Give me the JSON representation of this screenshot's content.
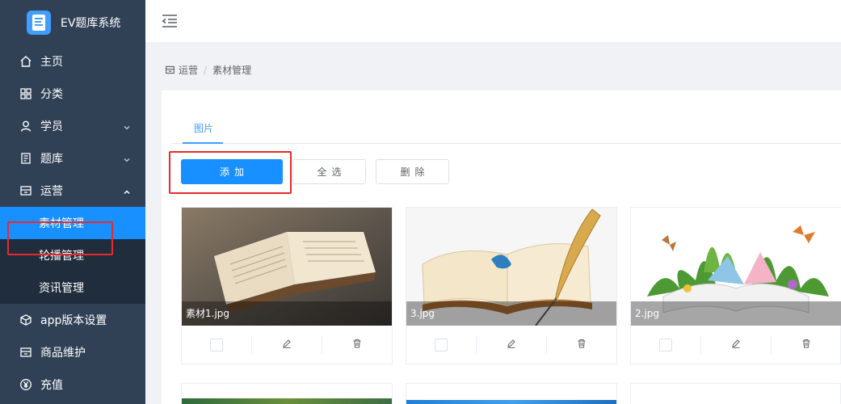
{
  "app": {
    "title": "EV题库系统"
  },
  "sidebar": {
    "items": [
      {
        "label": "主页",
        "icon": "home-icon"
      },
      {
        "label": "分类",
        "icon": "grid-icon"
      },
      {
        "label": "学员",
        "icon": "user-icon",
        "expandable": true
      },
      {
        "label": "题库",
        "icon": "question-bank-icon",
        "expandable": true
      },
      {
        "label": "运营",
        "icon": "operations-icon",
        "expanded": true,
        "children": [
          {
            "label": "素材管理",
            "active": true
          },
          {
            "label": "轮播管理"
          },
          {
            "label": "资讯管理"
          }
        ]
      },
      {
        "label": "app版本设置",
        "icon": "cube-icon"
      },
      {
        "label": "商品维护",
        "icon": "shop-icon"
      },
      {
        "label": "充值",
        "icon": "yen-icon"
      }
    ]
  },
  "breadcrumb": {
    "parent": "运营",
    "separator": "/",
    "current": "素材管理"
  },
  "tabs": [
    {
      "label": "图片",
      "active": true
    }
  ],
  "toolbar": {
    "add_label": "添加",
    "select_all_label": "全选",
    "delete_label": "删除"
  },
  "materials": [
    {
      "name": "素材1.jpg",
      "image": "open-book-photo"
    },
    {
      "name": "3.jpg",
      "image": "book-with-quill"
    },
    {
      "name": "2.jpg",
      "image": "book-with-plants-butterflies"
    }
  ],
  "colors": {
    "sidebar_bg": "#304156",
    "accent": "#1890ff",
    "highlight_box": "#e62b2b"
  }
}
